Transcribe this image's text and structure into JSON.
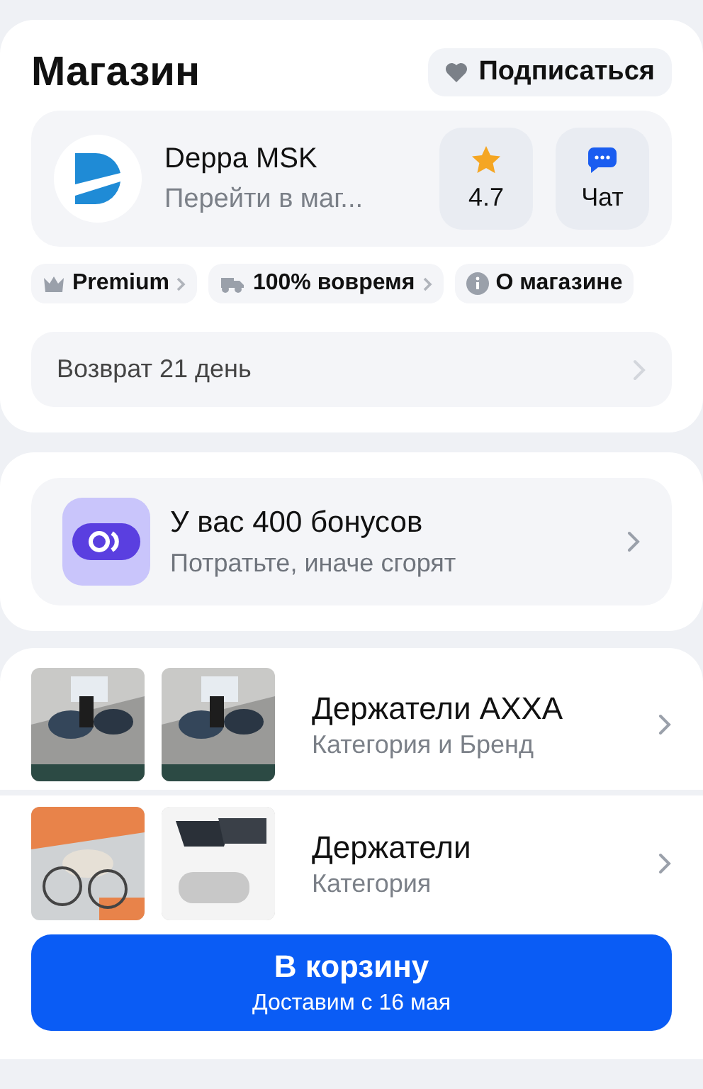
{
  "shop": {
    "title": "Магазин",
    "subscribe": "Подписаться",
    "seller": {
      "name": "Deppa MSK",
      "link": "Перейти в маг...",
      "rating": "4.7",
      "chat": "Чат"
    },
    "chips": [
      {
        "kind": "crown",
        "label": "Premium",
        "arrow": true
      },
      {
        "kind": "truck",
        "label": "100% вовремя",
        "arrow": true
      },
      {
        "kind": "info",
        "label": "О магазине",
        "arrow": false
      }
    ],
    "returns": "Возврат 21 день"
  },
  "bonus": {
    "title": "У вас 400 бонусов",
    "subtitle": "Потратьте, иначе сгорят"
  },
  "categories": [
    {
      "title": "Держатели АХХА",
      "subtitle": "Категория и Бренд"
    },
    {
      "title": "Держатели",
      "subtitle": "Категория"
    }
  ],
  "cart": {
    "label": "В корзину",
    "delivery": "Доставим с 16 мая"
  }
}
